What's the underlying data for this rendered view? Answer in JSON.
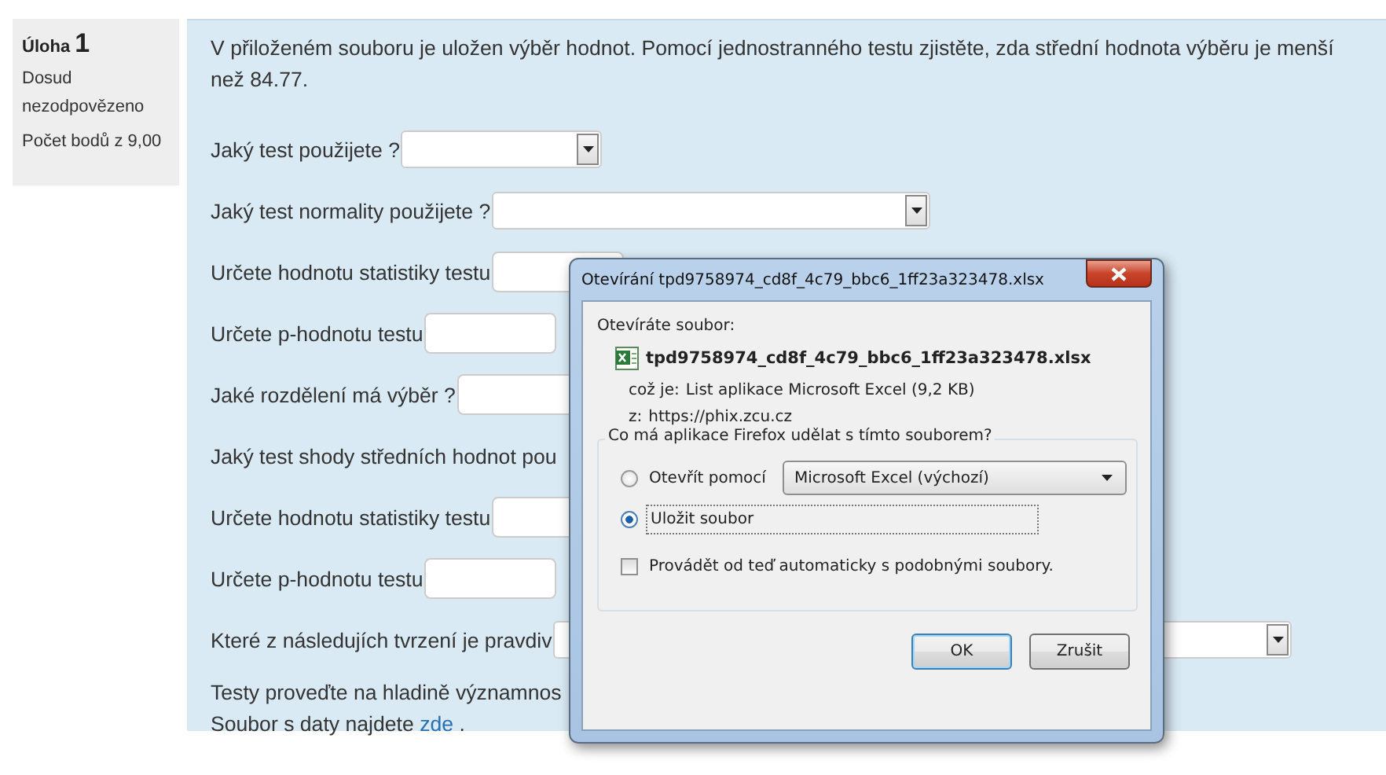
{
  "sidebar": {
    "label": "Úloha",
    "number": "1",
    "status": "Dosud nezodpovězeno",
    "points": "Počet bodů z 9,00"
  },
  "question": {
    "text": "V přiloženém souboru je uložen výběr hodnot. Pomocí jednostranného testu zjistěte, zda střední hodnota výběru je menší než 84.77.",
    "rows": [
      {
        "kind": "select",
        "label": "Jaký test použijete ?"
      },
      {
        "kind": "select",
        "label": "Jaký test normality použijete ?"
      },
      {
        "kind": "input",
        "label": "Určete hodnotu statistiky testu"
      },
      {
        "kind": "input",
        "label": "Určete p-hodnotu testu"
      },
      {
        "kind": "input",
        "label": "Jaké rozdělení má výběr ?"
      },
      {
        "kind": "text",
        "label": "Jaký test shody středních hodnot pou"
      },
      {
        "kind": "input",
        "label": "Určete hodnotu statistiky testu"
      },
      {
        "kind": "input",
        "label": "Určete p-hodnotu testu"
      },
      {
        "kind": "select",
        "label": "Které z následujích tvrzení je pravdiv"
      }
    ],
    "note": "Testy proveďte na hladině významnos",
    "file_line": {
      "text": "Soubor s daty najdete",
      "link": "zde",
      "end": "."
    }
  },
  "dialog": {
    "title": "Otevírání tpd9758974_cd8f_4c79_bbc6_1ff23a323478.xlsx",
    "intro": "Otevíráte soubor:",
    "filename": "tpd9758974_cd8f_4c79_bbc6_1ff23a323478.xlsx",
    "details": [
      {
        "key": "což je:",
        "value": "List aplikace Microsoft Excel (9,2 KB)"
      },
      {
        "key": "z:",
        "value": "https://phix.zcu.cz"
      }
    ],
    "group_title": "Co má aplikace Firefox udělat s tímto souborem?",
    "options": [
      {
        "label": "Otevřít pomocí",
        "selected": false,
        "app": "Microsoft Excel (výchozí)"
      },
      {
        "label": "Uložit soubor",
        "selected": true
      }
    ],
    "auto": {
      "label": "Provádět od teď automaticky s podobnými soubory.",
      "checked": false
    },
    "buttons": [
      "OK",
      "Zrušit"
    ]
  }
}
